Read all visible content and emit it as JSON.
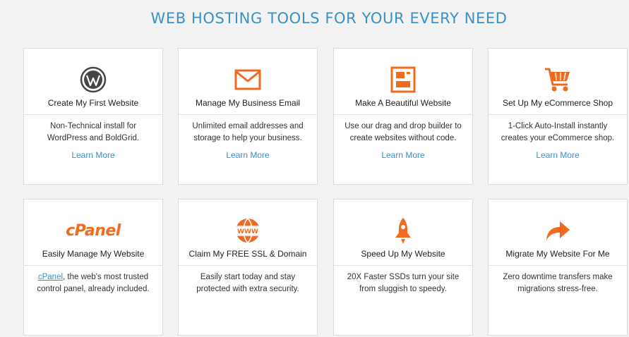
{
  "headline": "WEB HOSTING TOOLS FOR YOUR EVERY NEED",
  "colors": {
    "accent_blue": "#3d8fc4",
    "accent_orange": "#f06b1f"
  },
  "cards": [
    {
      "icon": "wordpress-icon",
      "title": "Create My First Website",
      "description": "Non-Technical install for WordPress and BoldGrid.",
      "link": "Learn More"
    },
    {
      "icon": "envelope-icon",
      "title": "Manage My Business Email",
      "description": "Unlimited email addresses and storage to help your business.",
      "link": "Learn More"
    },
    {
      "icon": "page-builder-icon",
      "title": "Make A Beautiful Website",
      "description": "Use our drag and drop builder to create websites without code.",
      "link": "Learn More"
    },
    {
      "icon": "shopping-cart-icon",
      "title": "Set Up My eCommerce Shop",
      "description": "1-Click Auto-Install instantly creates your eCommerce shop.",
      "link": "Learn More"
    },
    {
      "icon": "cpanel-logo",
      "logo_text": "cPanel",
      "title": "Easily Manage My Website",
      "description_link": "cPanel",
      "description": ", the web's most trusted control panel, already included."
    },
    {
      "icon": "www-globe-icon",
      "title": "Claim My FREE SSL & Domain",
      "description": "Easily start today and stay protected with extra security."
    },
    {
      "icon": "rocket-icon",
      "title": "Speed Up My Website",
      "description": "20X Faster SSDs turn your site from sluggish to speedy."
    },
    {
      "icon": "arrow-forward-icon",
      "title": "Migrate My Website For Me",
      "description": "Zero downtime transfers make migrations stress-free."
    }
  ]
}
